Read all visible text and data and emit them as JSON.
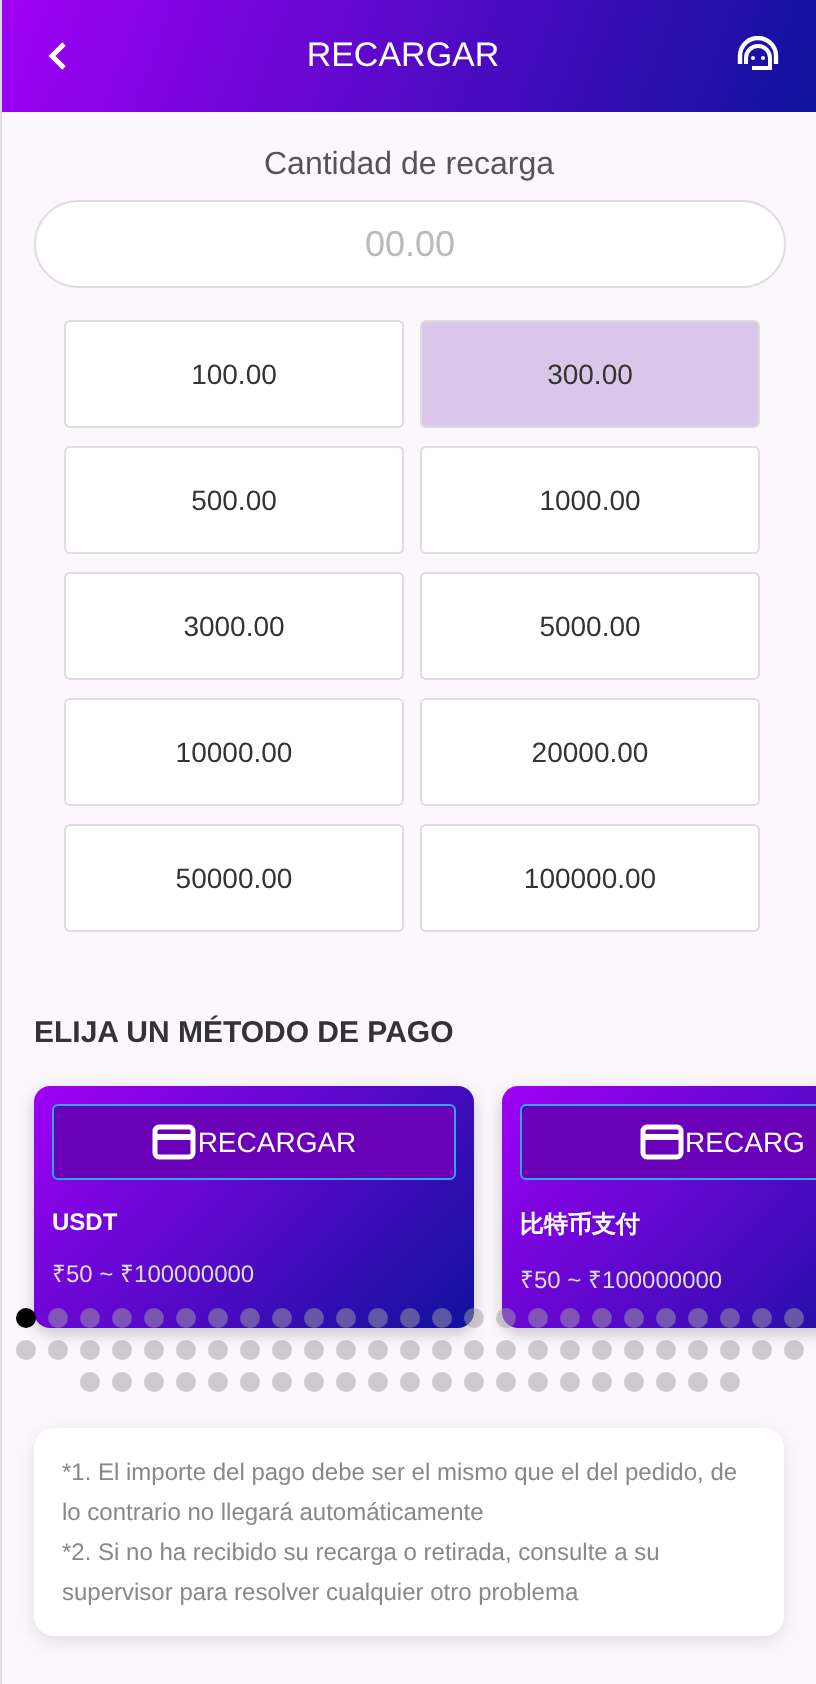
{
  "header": {
    "title": "RECARGAR"
  },
  "amount": {
    "label": "Cantidad de recarga",
    "placeholder": "00.00"
  },
  "options": [
    {
      "label": "100.00",
      "selected": false
    },
    {
      "label": "300.00",
      "selected": true
    },
    {
      "label": "500.00",
      "selected": false
    },
    {
      "label": "1000.00",
      "selected": false
    },
    {
      "label": "3000.00",
      "selected": false
    },
    {
      "label": "5000.00",
      "selected": false
    },
    {
      "label": "10000.00",
      "selected": false
    },
    {
      "label": "20000.00",
      "selected": false
    },
    {
      "label": "50000.00",
      "selected": false
    },
    {
      "label": "100000.00",
      "selected": false
    }
  ],
  "methods_title": "ELIJA UN MÉTODO DE PAGO",
  "methods": [
    {
      "button": "RECARGAR",
      "name": "USDT",
      "range": "₹50 ~ ₹100000000"
    },
    {
      "button": "RECARG",
      "name": "比特币支付",
      "range": "₹50 ~ ₹100000000"
    }
  ],
  "pagination": [
    {
      "selected": true
    },
    {
      "selected": false
    },
    {
      "selected": false
    },
    {
      "selected": false
    },
    {
      "selected": false
    },
    {
      "selected": false
    },
    {
      "selected": false
    },
    {
      "selected": false
    },
    {
      "selected": false
    },
    {
      "selected": false
    },
    {
      "selected": false
    },
    {
      "selected": false
    },
    {
      "selected": false
    },
    {
      "selected": false
    },
    {
      "selected": false
    },
    {
      "selected": false
    },
    {
      "selected": false
    },
    {
      "selected": false
    },
    {
      "selected": false
    },
    {
      "selected": false
    },
    {
      "selected": false
    },
    {
      "selected": false
    },
    {
      "selected": false
    },
    {
      "selected": false
    },
    {
      "selected": false
    },
    {
      "selected": false
    },
    {
      "selected": false
    },
    {
      "selected": false
    },
    {
      "selected": false
    },
    {
      "selected": false
    },
    {
      "selected": false
    },
    {
      "selected": false
    },
    {
      "selected": false
    },
    {
      "selected": false
    },
    {
      "selected": false
    },
    {
      "selected": false
    },
    {
      "selected": false
    },
    {
      "selected": false
    },
    {
      "selected": false
    },
    {
      "selected": false
    },
    {
      "selected": false
    },
    {
      "selected": false
    },
    {
      "selected": false
    },
    {
      "selected": false
    },
    {
      "selected": false
    },
    {
      "selected": false
    },
    {
      "selected": false
    },
    {
      "selected": false
    },
    {
      "selected": false
    },
    {
      "selected": false
    },
    {
      "selected": false
    },
    {
      "selected": false
    },
    {
      "selected": false
    },
    {
      "selected": false
    },
    {
      "selected": false
    },
    {
      "selected": false
    },
    {
      "selected": false
    },
    {
      "selected": false
    },
    {
      "selected": false
    },
    {
      "selected": false
    },
    {
      "selected": false
    },
    {
      "selected": false
    },
    {
      "selected": false
    },
    {
      "selected": false
    },
    {
      "selected": false
    },
    {
      "selected": false
    },
    {
      "selected": false
    },
    {
      "selected": false
    },
    {
      "selected": false
    },
    {
      "selected": false
    },
    {
      "selected": false
    }
  ],
  "notes": [
    "*1. El importe del pago debe ser el mismo que el del pedido, de lo contrario no llegará automáticamente",
    "*2. Si no ha recibido su recarga o retirada, consulte a su supervisor para resolver cualquier otro problema"
  ]
}
